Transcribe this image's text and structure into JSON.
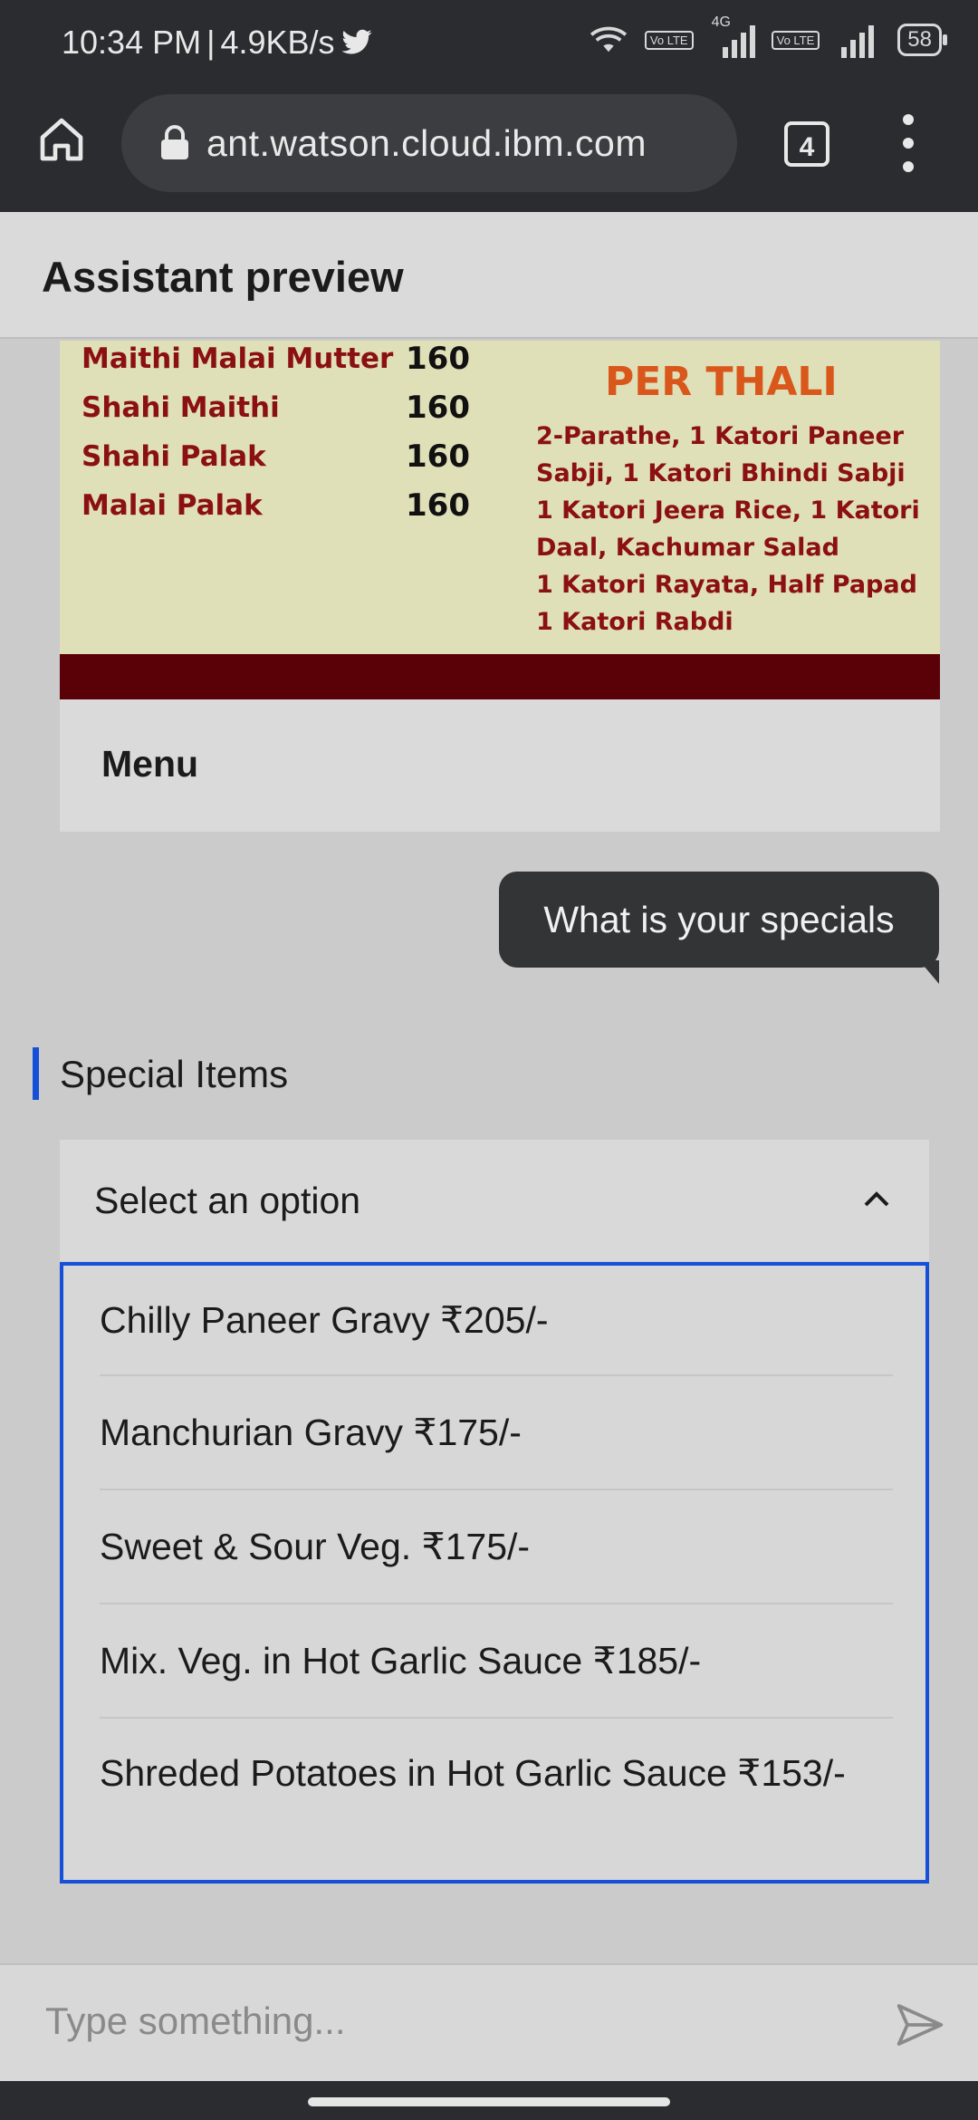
{
  "status_bar": {
    "time": "10:34 PM",
    "separator": "|",
    "speed": "4.9KB/s",
    "network_type": "4G",
    "lte_label": "Vo LTE",
    "battery": "58"
  },
  "browser": {
    "url": "ant.watson.cloud.ibm.com",
    "tab_count": "4"
  },
  "header": {
    "title": "Assistant preview"
  },
  "menu_image": {
    "dishes": [
      {
        "name": "Maithi Malai Mutter",
        "price": "160"
      },
      {
        "name": "Shahi Maithi",
        "price": "160"
      },
      {
        "name": "Shahi Palak",
        "price": "160"
      },
      {
        "name": "Malai Palak",
        "price": "160"
      }
    ],
    "thali_title": "PER THALI",
    "thali_lines": [
      "2-Parathe, 1 Katori Paneer",
      "Sabji, 1 Katori Bhindi Sabji",
      "1 Katori Jeera Rice, 1 Katori",
      "Daal, Kachumar Salad",
      "1 Katori Rayata, Half Papad",
      "1 Katori Rabdi"
    ],
    "caption": "Menu"
  },
  "chat": {
    "user_message": "What is your specials",
    "section_title": "Special Items",
    "select_placeholder": "Select an option",
    "options": [
      "Chilly Paneer Gravy ₹205/-",
      "Manchurian Gravy ₹175/-",
      "Sweet & Sour Veg. ₹175/-",
      "Mix. Veg. in Hot Garlic Sauce ₹185/-",
      "Shreded Potatoes in Hot Garlic Sauce ₹153/-"
    ]
  },
  "composer": {
    "placeholder": "Type something..."
  },
  "colors": {
    "accent": "#1650d9",
    "bubble": "#333436",
    "chrome": "#2b2c2f"
  }
}
